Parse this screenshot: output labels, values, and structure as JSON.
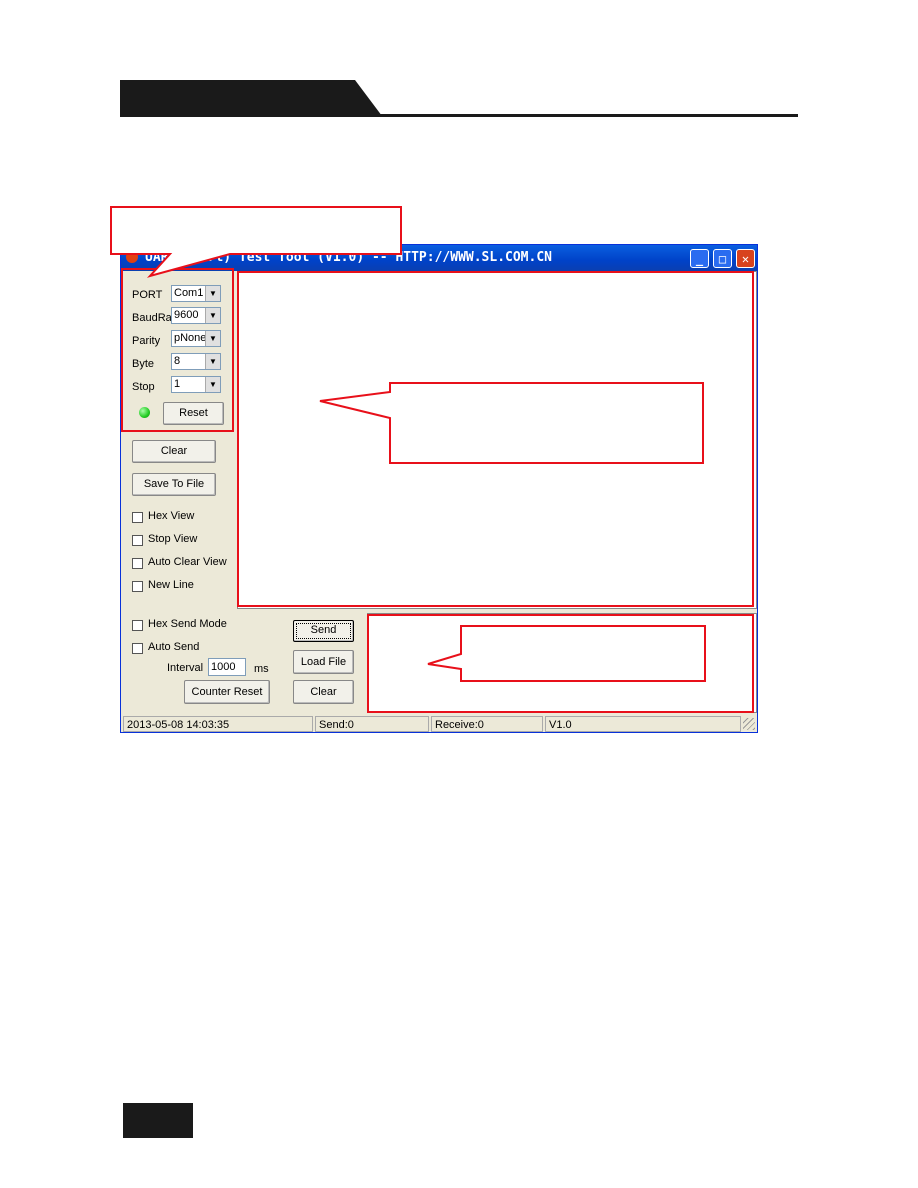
{
  "window": {
    "title": "UART (Port) Test Tool (V1.0) -- HTTP://WWW.SL.COM.CN",
    "minimize": "_",
    "maximize": "□",
    "close": "✕"
  },
  "settings": {
    "port": {
      "label": "PORT",
      "value": "Com1"
    },
    "baud": {
      "label": "BaudRa",
      "value": "9600"
    },
    "parity": {
      "label": "Parity",
      "value": "pNone"
    },
    "byte": {
      "label": "Byte",
      "value": "8"
    },
    "stop": {
      "label": "Stop",
      "value": "1"
    },
    "reset": "Reset",
    "status_led_color": "#22cc22"
  },
  "view": {
    "clear": "Clear",
    "save": "Save To File",
    "hex_view": "Hex View",
    "stop_view": "Stop View",
    "auto_clear": "Auto Clear View",
    "new_line": "New Line"
  },
  "send": {
    "hex_mode": "Hex Send Mode",
    "auto_send": "Auto Send",
    "interval_label": "Interval",
    "interval_value": "1000",
    "ms": "ms",
    "counter_reset": "Counter Reset",
    "send": "Send",
    "load_file": "Load File",
    "clear": "Clear"
  },
  "status": {
    "datetime": "2013-05-08 14:03:35",
    "send": "Send:0",
    "receive": "Receive:0",
    "version": "V1.0"
  },
  "annotation_color": "#e8101a"
}
